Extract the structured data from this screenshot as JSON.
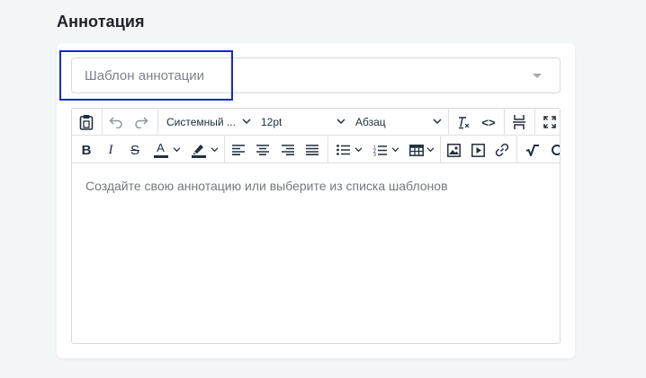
{
  "section": {
    "title": "Аннотация"
  },
  "template_select": {
    "placeholder": "Шаблон аннотации"
  },
  "toolbar": {
    "font_family": "Системный ...",
    "font_size": "12pt",
    "block_format": "Абзац",
    "bold": "B",
    "italic": "I",
    "strike": "S",
    "text_color": "A",
    "code": "<>"
  },
  "editor": {
    "placeholder": "Создайте свою аннотацию или выберите из списка шаблонов"
  },
  "colors": {
    "focus_outline": "#1428d6",
    "text_color_swatch": "#222f3e",
    "highlight_swatch": "#222f3e"
  },
  "icons": [
    "paste-icon",
    "undo-icon",
    "redo-icon",
    "clear-formatting-icon",
    "code-icon",
    "page-break-icon",
    "fullscreen-icon",
    "align-left-icon",
    "align-center-icon",
    "align-right-icon",
    "align-justify-icon",
    "bullet-list-icon",
    "numbered-list-icon",
    "table-icon",
    "image-icon",
    "media-icon",
    "link-icon",
    "math-icon",
    "special-icon"
  ]
}
